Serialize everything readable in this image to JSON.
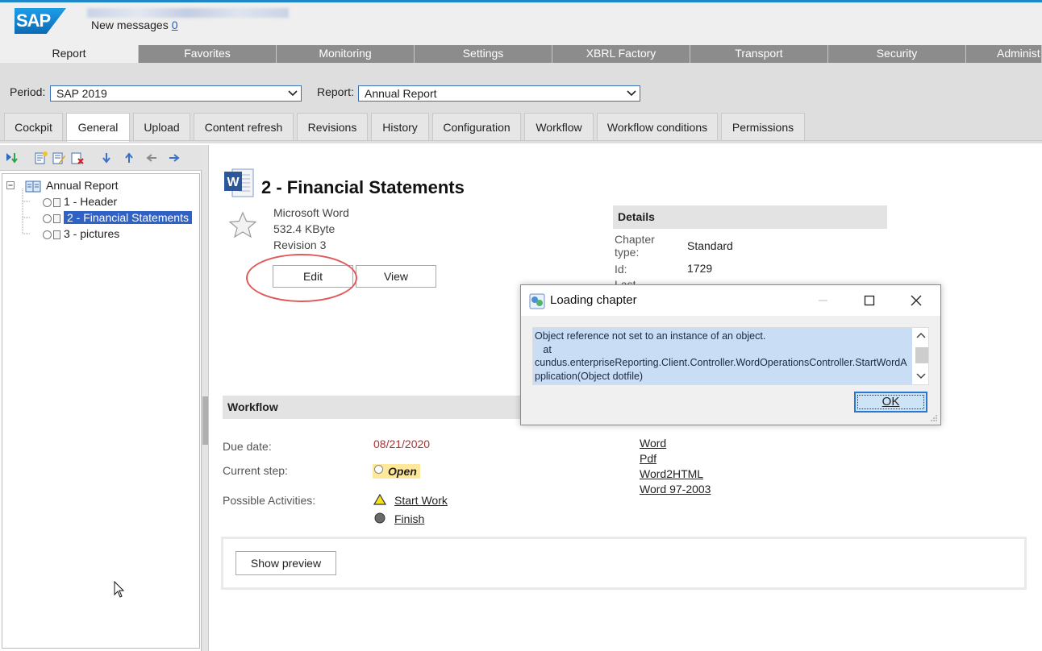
{
  "header": {
    "logo_text": "SAP",
    "messages_label": "New messages",
    "messages_count": "0"
  },
  "topmenu": [
    "Report",
    "Favorites",
    "Monitoring",
    "Settings",
    "XBRL Factory",
    "Transport",
    "Security",
    "Administ"
  ],
  "filters": {
    "period_label": "Period:",
    "period_value": "SAP 2019",
    "report_label": "Report:",
    "report_value": "Annual Report"
  },
  "tabs": [
    "Cockpit",
    "General",
    "Upload",
    "Content refresh",
    "Revisions",
    "History",
    "Configuration",
    "Workflow",
    "Workflow conditions",
    "Permissions"
  ],
  "active_tab": "General",
  "tree": {
    "root": "Annual Report",
    "items": [
      "1 - Header",
      "2 - Financial Statements",
      "3 - pictures"
    ],
    "selected_index": 1
  },
  "document": {
    "title": "2 - Financial Statements",
    "app": "Microsoft Word",
    "size": "532.4 KByte",
    "revision": "Revision 3",
    "edit_label": "Edit",
    "view_label": "View"
  },
  "details": {
    "heading": "Details",
    "chapter_type_label": "Chapter type:",
    "chapter_type_value": "Standard",
    "id_label": "Id:",
    "id_value": "1729",
    "last_label": "Last"
  },
  "workflow": {
    "heading": "Workflow",
    "due_label": "Due date:",
    "due_value": "08/21/2020",
    "step_label": "Current step:",
    "step_value": "Open",
    "activities_label": "Possible Activities:",
    "activities": [
      "Start Work",
      "Finish"
    ],
    "downloads": [
      "Word",
      "Pdf",
      "Word2HTML",
      "Word 97-2003"
    ],
    "preview_label": "Show preview"
  },
  "dialog": {
    "title": "Loading chapter",
    "line1": "Object reference not set to an instance of an object.",
    "line2": "   at",
    "line3": "cundus.enterpriseReporting.Client.Controller.WordOperationsController.StartWordApplication(Object dotfile)",
    "ok_label": "OK"
  },
  "colors": {
    "accent": "#1d87c9",
    "selection": "#2f62c4",
    "due_date": "#a33333",
    "highlight": "#ffe89a",
    "annotation_circle": "#e05a5a"
  }
}
